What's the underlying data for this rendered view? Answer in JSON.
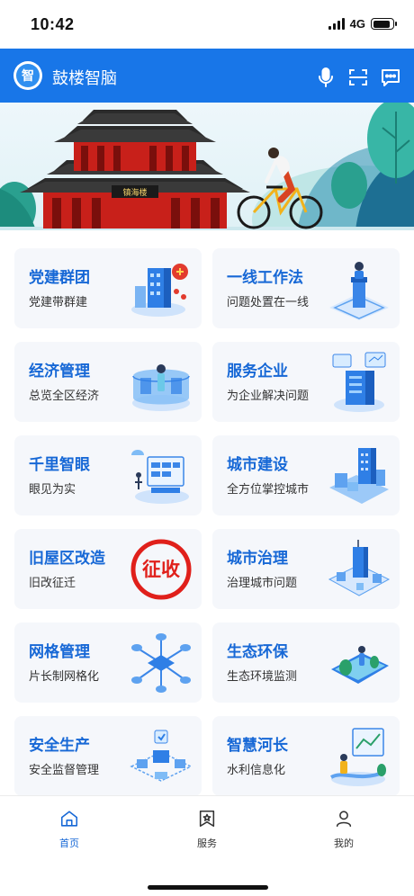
{
  "status_bar": {
    "time": "10:42",
    "network": "4G",
    "battery_level": 0.9
  },
  "header": {
    "logo_char": "智",
    "title": "鼓楼智脑",
    "icons": [
      "microphone-icon",
      "scan-icon",
      "message-icon"
    ]
  },
  "banner": {
    "sign_text": "镇海楼"
  },
  "cards": [
    {
      "title": "党建群团",
      "subtitle": "党建带群建",
      "icon": "party-building-icon"
    },
    {
      "title": "一线工作法",
      "subtitle": "问题处置在一线",
      "icon": "podium-icon"
    },
    {
      "title": "经济管理",
      "subtitle": "总览全区经济",
      "icon": "economy-dashboard-icon"
    },
    {
      "title": "服务企业",
      "subtitle": "为企业解决问题",
      "icon": "enterprise-server-icon"
    },
    {
      "title": "千里智眼",
      "subtitle": "眼见为实",
      "icon": "monitor-eye-icon"
    },
    {
      "title": "城市建设",
      "subtitle": "全方位掌控城市",
      "icon": "city-building-icon"
    },
    {
      "title": "旧屋区改造",
      "subtitle": "旧改征迁",
      "icon": "expropriation-stamp-icon",
      "stamp_text": "征收"
    },
    {
      "title": "城市治理",
      "subtitle": "治理城市问题",
      "icon": "city-governance-icon"
    },
    {
      "title": "网格管理",
      "subtitle": "片长制网格化",
      "icon": "grid-network-icon"
    },
    {
      "title": "生态环保",
      "subtitle": "生态环境监测",
      "icon": "ecology-monitor-icon"
    },
    {
      "title": "安全生产",
      "subtitle": "安全监督管理",
      "icon": "safety-production-icon"
    },
    {
      "title": "智慧河长",
      "subtitle": "水利信息化",
      "icon": "river-chief-icon"
    }
  ],
  "tabs": [
    {
      "label": "首页",
      "icon": "home-icon",
      "active": true
    },
    {
      "label": "服务",
      "icon": "service-bookmark-icon",
      "active": false
    },
    {
      "label": "我的",
      "icon": "profile-icon",
      "active": false
    }
  ],
  "colors": {
    "brand": "#1876e8",
    "card_title": "#1768d6",
    "card_bg": "#f5f7fb",
    "stamp_red": "#e0201b"
  }
}
